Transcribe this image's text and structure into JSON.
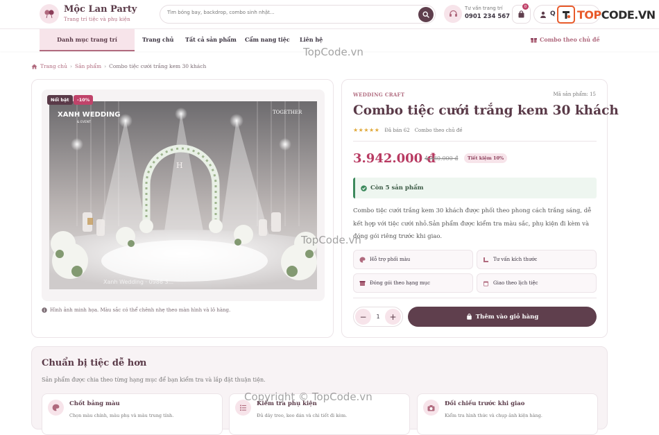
{
  "header": {
    "brand_name": "Mộc Lan Party",
    "brand_tagline": "Trang trí tiệc và phụ kiện",
    "search_placeholder": "Tìm bóng bay, backdrop, combo sinh nhật...",
    "consult_label": "Tư vấn trang trí",
    "consult_phone": "0901 234 567",
    "cart_count": "0",
    "account_initial": "Q",
    "watermark_logo": "TOPCODE.VN",
    "watermark_logo_accent": "TOP",
    "watermark_logo_rest": "CODE.VN"
  },
  "nav": {
    "category_menu": "Danh mục trang trí",
    "links": [
      "Trang chủ",
      "Tất cả sản phẩm",
      "Cẩm nang tiệc",
      "Liên hệ"
    ],
    "theme_combo": "Combo theo chủ đề"
  },
  "watermarks": [
    "TopCode.vn",
    "TopCode.vn",
    "Copyright © TopCode.vn"
  ],
  "breadcrumb": [
    "Trang chủ",
    "Sản phẩm",
    "Combo tiệc cưới trắng kem 30 khách"
  ],
  "gallery": {
    "badge_hot": "Nổi bật",
    "badge_discount": "-10%",
    "photo_text_left": "XANH WEDDING",
    "photo_text_left_sub": "& EVENT",
    "photo_text_right": "TOGETHER",
    "photo_text_bottom": "Xanh Wedding · 0986 3...",
    "note": "Hình ảnh minh họa. Màu sắc có thể chênh nhẹ theo màn hình và lô hàng."
  },
  "product": {
    "brand": "WEDDING CRAFT",
    "sku": "Mã sản phẩm: 15",
    "title": "Combo tiệc cưới trắng kem 30 khách",
    "rating_stars": "★★★★★",
    "rating_value": 5,
    "sold": "Đã bán 62",
    "category": "Combo theo chủ đề",
    "price": "3.942.000 đ",
    "old_price": "4.380.000 đ",
    "save": "Tiết kiệm 10%",
    "stock": "Còn 5 sản phẩm",
    "description": "Combo tiệc cưới trắng kem 30 khách được phối theo phong cách trắng sáng, dễ kết hợp với tiệc cưới nhỏ.Sản phẩm được kiểm tra màu sắc, phụ kiện đi kèm và đóng gói riêng trước khi giao.",
    "features": [
      "Hỗ trợ phối màu",
      "Tư vấn kích thước",
      "Đóng gói theo hạng mục",
      "Giao theo lịch tiệc"
    ],
    "quantity": "1",
    "add_to_cart": "Thêm vào giỏ hàng"
  },
  "prep": {
    "title": "Chuẩn bị tiệc dễ hơn",
    "subtitle": "Sản phẩm được chia theo từng hạng mục để bạn kiểm tra và lắp đặt thuận tiện.",
    "steps": [
      {
        "title": "Chốt bảng màu",
        "desc": "Chọn màu chính, màu phụ và màu trung tính."
      },
      {
        "title": "Kiểm tra phụ kiện",
        "desc": "Đủ dây treo, keo dán và chi tiết đi kèm."
      },
      {
        "title": "Đối chiếu trước khi giao",
        "desc": "Kiểm tra hình thức và chụp ảnh kiện hàng."
      }
    ]
  },
  "colors": {
    "brand_dark": "#5f3f4d",
    "accent_pink": "#b06a7e",
    "price_red": "#b83a62",
    "soft_pink": "#f7e4ea",
    "success_green": "#3d8a5d",
    "star_gold": "#e0a93a"
  },
  "icons": {
    "logo": "party-balloon-icon",
    "search": "search-icon",
    "consult": "headset-icon",
    "cart": "shopping-bag-icon",
    "account": "user-icon",
    "gift": "gift-icon",
    "home": "home-icon",
    "info": "info-icon",
    "stock": "check-circle-icon",
    "palette": "palette-icon",
    "ruler": "ruler-icon",
    "box": "box-icon",
    "calendar": "calendar-icon",
    "list": "list-icon",
    "camera": "camera-icon"
  }
}
